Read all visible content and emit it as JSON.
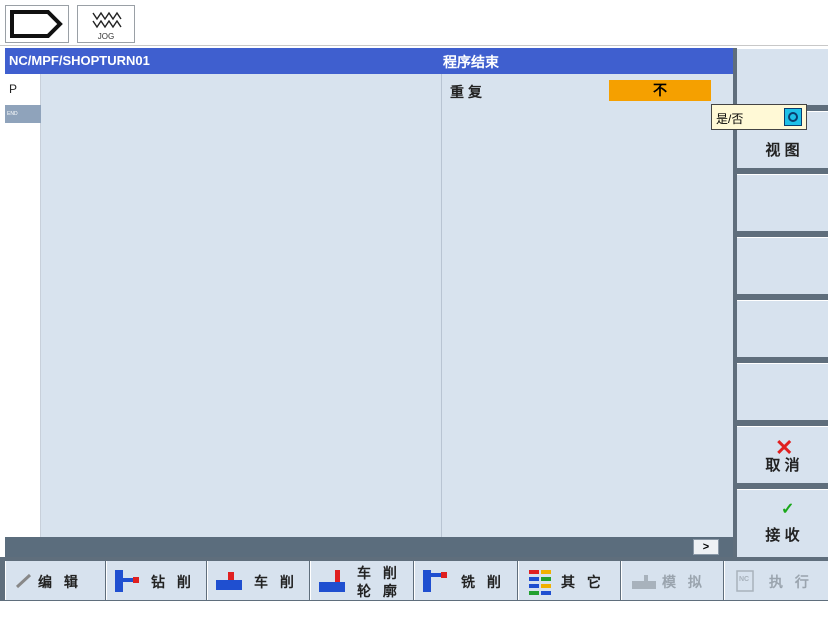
{
  "topbar": {
    "jog_label": "JOG"
  },
  "header": {
    "path": "NC/MPF/SHOPTURN01",
    "title": "程序结束"
  },
  "editor": {
    "gutter_marker": "P",
    "end_marker": "END"
  },
  "params": {
    "repeat_label": "重复",
    "repeat_value": "不"
  },
  "tooltip": {
    "text": "是/否"
  },
  "statusbar": {
    "next_label": ">"
  },
  "right_softkeys": {
    "view": "视 图",
    "cancel": "取 消",
    "accept": "接 收"
  },
  "bottom_softkeys": [
    {
      "label": "编 辑",
      "icon": "pencil-icon"
    },
    {
      "label": "钻 削",
      "icon": "drill-icon"
    },
    {
      "label": "车 削",
      "icon": "turning-icon"
    },
    {
      "label_line1": "车 削",
      "label_line2": "轮 廓",
      "icon": "contour-turning-icon"
    },
    {
      "label": "铣 削",
      "icon": "milling-icon"
    },
    {
      "label": "其 它",
      "icon": "misc-icon"
    },
    {
      "label": "模 拟",
      "icon": "simulation-icon"
    },
    {
      "label": "执 行",
      "icon": "execute-icon"
    }
  ],
  "colors": {
    "header_bg": "#3f5fcf",
    "value_highlight": "#f5a000",
    "panel_bg": "#d8e3ee",
    "softkey_frame": "#5f6e7c"
  }
}
